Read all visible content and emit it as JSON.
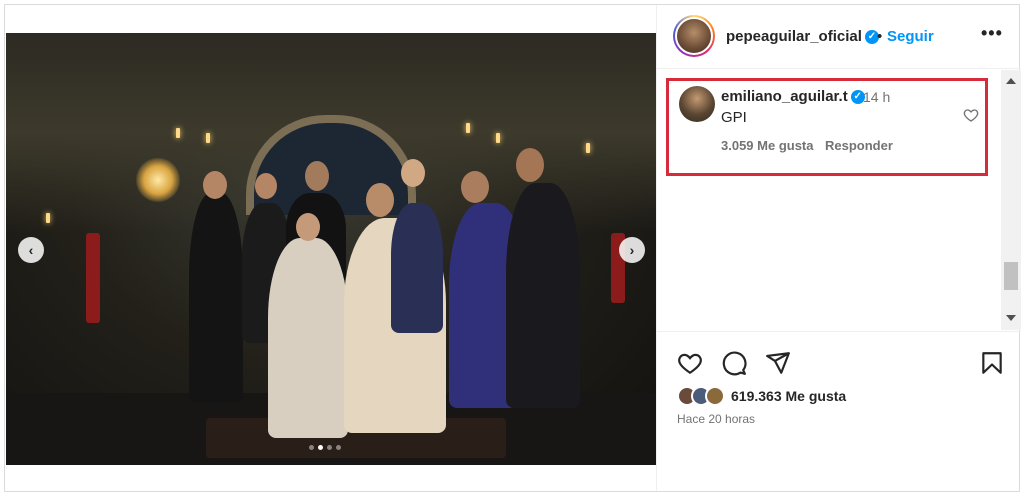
{
  "post": {
    "carousel": {
      "slide_count": 4,
      "active_slide": 2
    }
  },
  "header": {
    "username": "pepeaguilar_oficial",
    "separator": "•",
    "follow_label": "Seguir",
    "more_icon": "more-icon"
  },
  "comment": {
    "username": "emiliano_aguilar.t",
    "time": "14 h",
    "text": "GPI",
    "likes": "3.059 Me gusta",
    "reply_label": "Responder"
  },
  "footer": {
    "likes_count": "619.363 Me gusta",
    "posted_ago": "Hace 20 horas"
  },
  "colors": {
    "accent": "#0095f6",
    "highlight_box": "#d62b3a",
    "muted_text": "#737373"
  }
}
